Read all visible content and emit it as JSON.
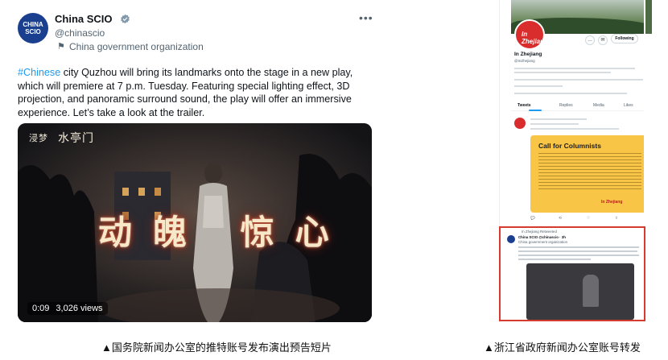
{
  "tweet": {
    "account_name": "China SCIO",
    "handle": "@chinascio",
    "affiliation": "China government organization",
    "avatar_text": [
      "CHINA",
      "SCIO"
    ],
    "text_hashtag": "#Chinese",
    "text_body": " city Quzhou will bring its landmarks onto the stage in a new play, which will premiere at 7 p.m. Tuesday. Featuring special lighting effect, 3D projection, and panoramic surround sound, the play will offer an immersive experience. Let’s take a look at the trailer.",
    "more_icon": "more-horizontal-icon"
  },
  "video": {
    "stamp_small": "浸梦",
    "stamp_large": "水亭门",
    "title": "动魄 惊心",
    "duration": "0:09",
    "views": "3,026 views"
  },
  "captions": {
    "left": "▲国务院新闻办公室的推特账号发布演出预告短片",
    "right": "▲浙江省政府新闻办公室账号转发"
  },
  "right_screenshot": {
    "avatar_text": "In Zhejiang",
    "follow_label": "Following",
    "profile_name": "In Zhejiang",
    "profile_handle": "@InZhejiang",
    "tabs": [
      "Tweets",
      "Replies",
      "Media",
      "Likes"
    ],
    "card_title": "Call for Columnists",
    "card_logo": "In Zhejiang",
    "retweet_header": "In Zhejiang Retweeted",
    "retweet_account": "China SCIO @chinascio · 3h",
    "retweet_affiliation": "China government organization"
  },
  "colors": {
    "accent": "#1d9bf0",
    "caption_box": "#d63b2f",
    "card_yellow": "#f9c547"
  }
}
